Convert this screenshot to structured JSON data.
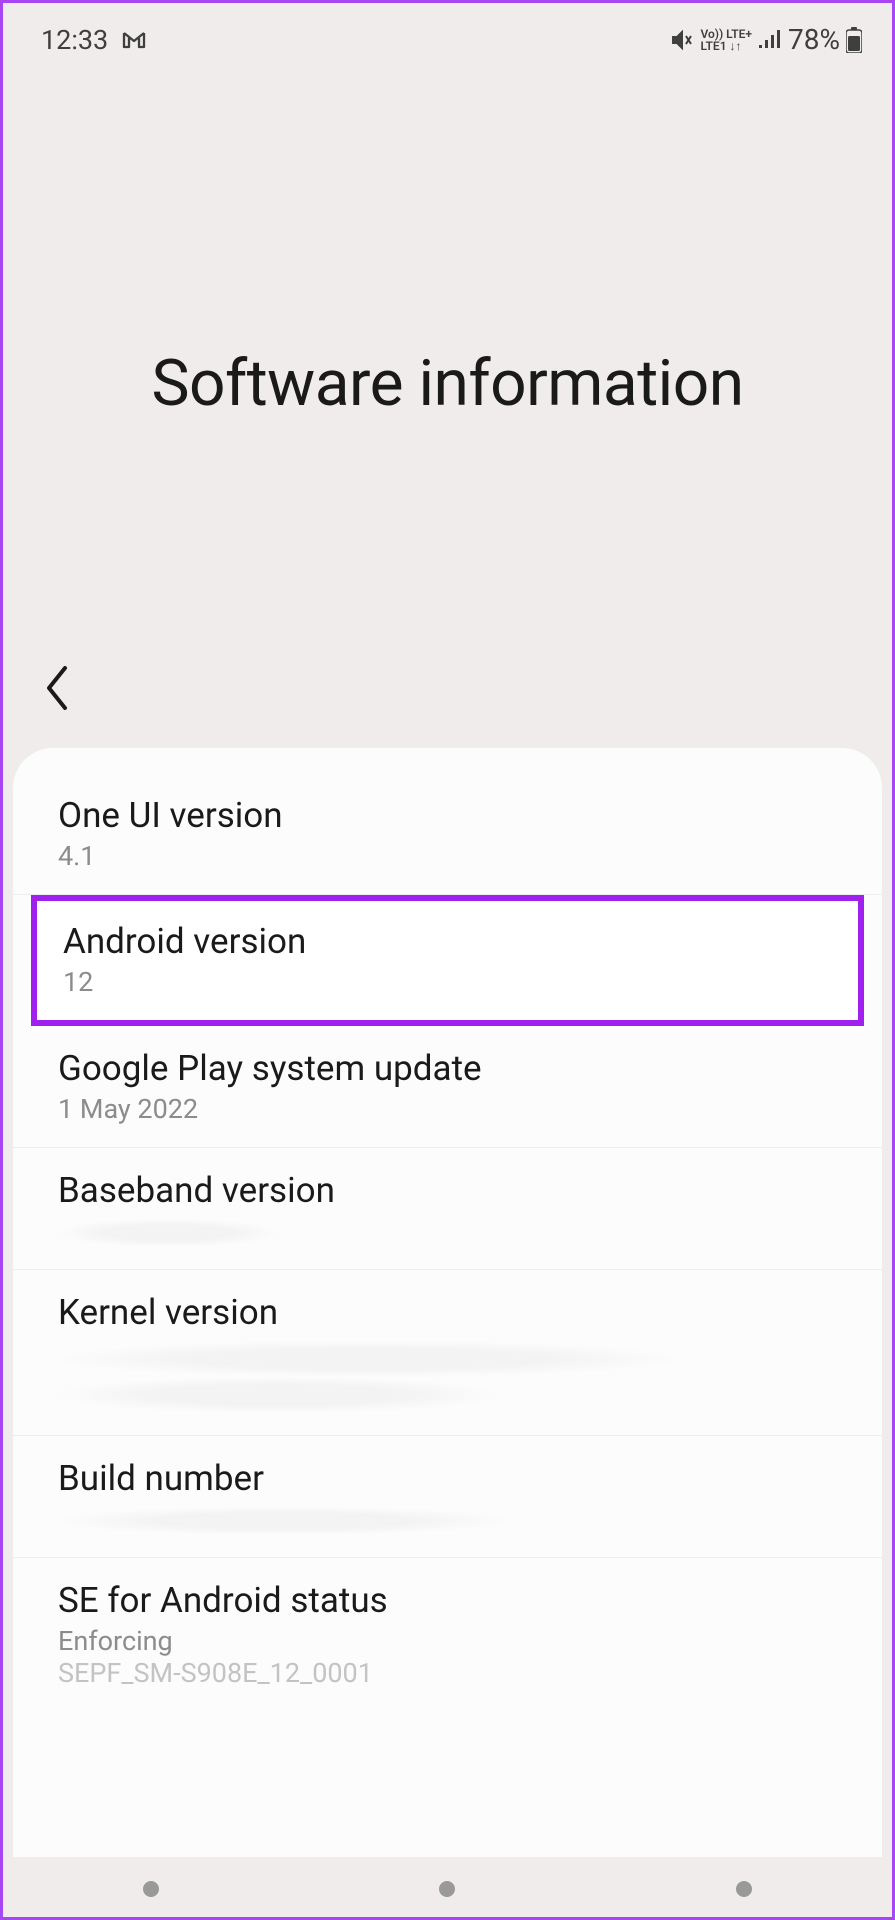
{
  "statusBar": {
    "time": "12:33",
    "batteryPercent": "78%",
    "lteTop": "Vo)) LTE+",
    "lteBottom": "LTE1 ↓↑"
  },
  "header": {
    "title": "Software information"
  },
  "items": [
    {
      "title": "One UI version",
      "value": "4.1",
      "blurred": false,
      "highlighted": false
    },
    {
      "title": "Android version",
      "value": "12",
      "blurred": false,
      "highlighted": true
    },
    {
      "title": "Google Play system update",
      "value": "1 May 2022",
      "blurred": false,
      "highlighted": false
    },
    {
      "title": "Baseband version",
      "value": "XXXXXXXXXXX",
      "blurred": true,
      "highlighted": false,
      "redactWidth": "220px"
    },
    {
      "title": "Kernel version",
      "value": "XXXXXXXXXXXXXXXXXXXXXXXX",
      "blurred": true,
      "highlighted": false,
      "redactWidth": "620px",
      "redactHeight": "70px"
    },
    {
      "title": "Build number",
      "value": "XXXXXXXXXXXXXXXXX",
      "blurred": true,
      "highlighted": false,
      "redactWidth": "450px"
    },
    {
      "title": "SE for Android status",
      "value": "Enforcing",
      "value2": "SEPF_SM-S908E_12_0001",
      "blurred": false,
      "highlighted": false
    }
  ]
}
